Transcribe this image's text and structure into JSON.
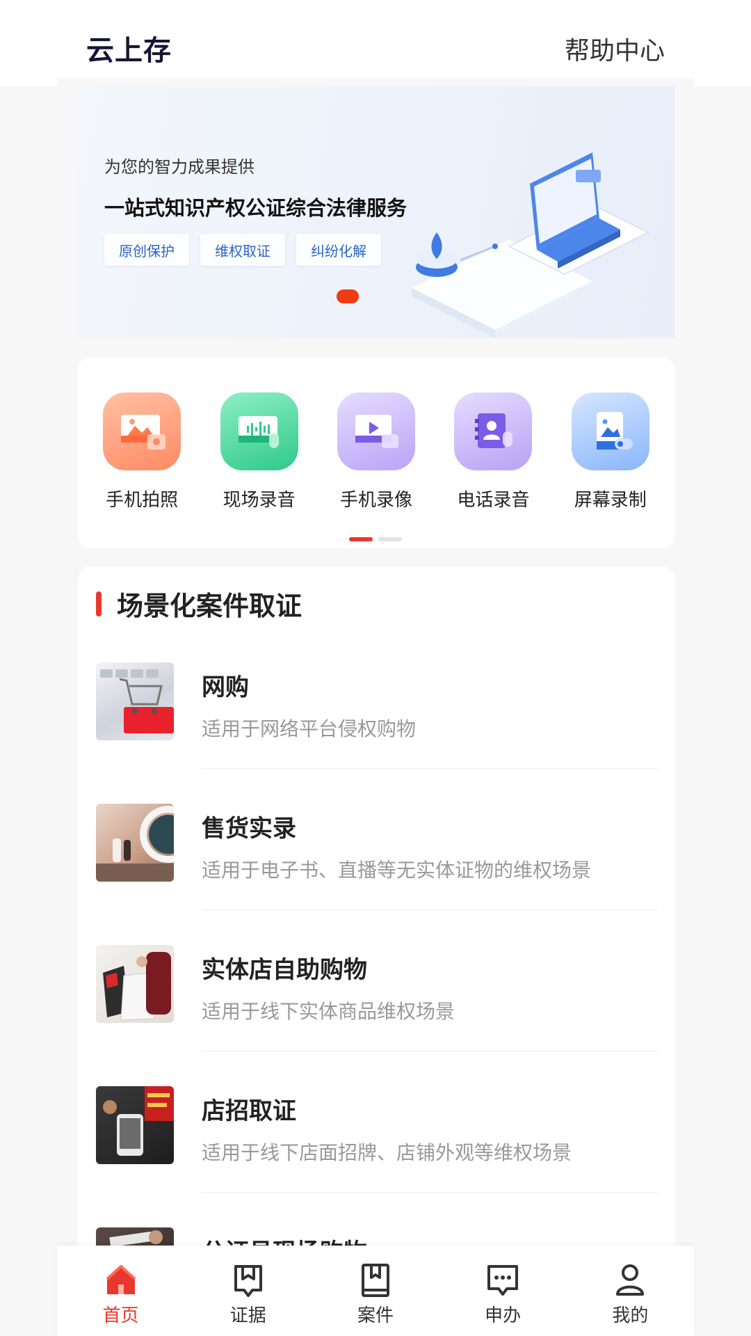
{
  "header": {
    "title": "云上存",
    "help": "帮助中心"
  },
  "banner": {
    "subtitle": "为您的智力成果提供",
    "title": "一站式知识产权公证综合法律服务",
    "tags": [
      "原创保护",
      "维权取证",
      "纠纷化解"
    ]
  },
  "shortcuts": {
    "items": [
      {
        "label": "手机拍照",
        "icon": "camera-photo-icon",
        "color": "#ff9a78"
      },
      {
        "label": "现场录音",
        "icon": "audio-record-icon",
        "color": "#3fd69a"
      },
      {
        "label": "手机录像",
        "icon": "video-record-icon",
        "color": "#a78cf5"
      },
      {
        "label": "电话录音",
        "icon": "phone-record-icon",
        "color": "#9f86f0"
      },
      {
        "label": "屏幕录制",
        "icon": "screen-record-icon",
        "color": "#5b95f5"
      }
    ]
  },
  "scenarios": {
    "title": "场景化案件取证",
    "items": [
      {
        "title": "网购",
        "desc": "适用于网络平台侵权购物"
      },
      {
        "title": "售货实录",
        "desc": "适用于电子书、直播等无实体证物的维权场景"
      },
      {
        "title": "实体店自助购物",
        "desc": "适用于线下实体商品维权场景"
      },
      {
        "title": "店招取证",
        "desc": "适用于线下店面招牌、店铺外观等维权场景"
      },
      {
        "title": "公证员现场购物",
        "desc": ""
      }
    ]
  },
  "nav": {
    "items": [
      {
        "label": "首页",
        "icon": "home-icon",
        "active": true
      },
      {
        "label": "证据",
        "icon": "evidence-icon",
        "active": false
      },
      {
        "label": "案件",
        "icon": "case-icon",
        "active": false
      },
      {
        "label": "申办",
        "icon": "apply-icon",
        "active": false
      },
      {
        "label": "我的",
        "icon": "profile-icon",
        "active": false
      }
    ]
  },
  "colors": {
    "accent": "#e8382e",
    "banner_tag_text": "#2a63c6"
  }
}
